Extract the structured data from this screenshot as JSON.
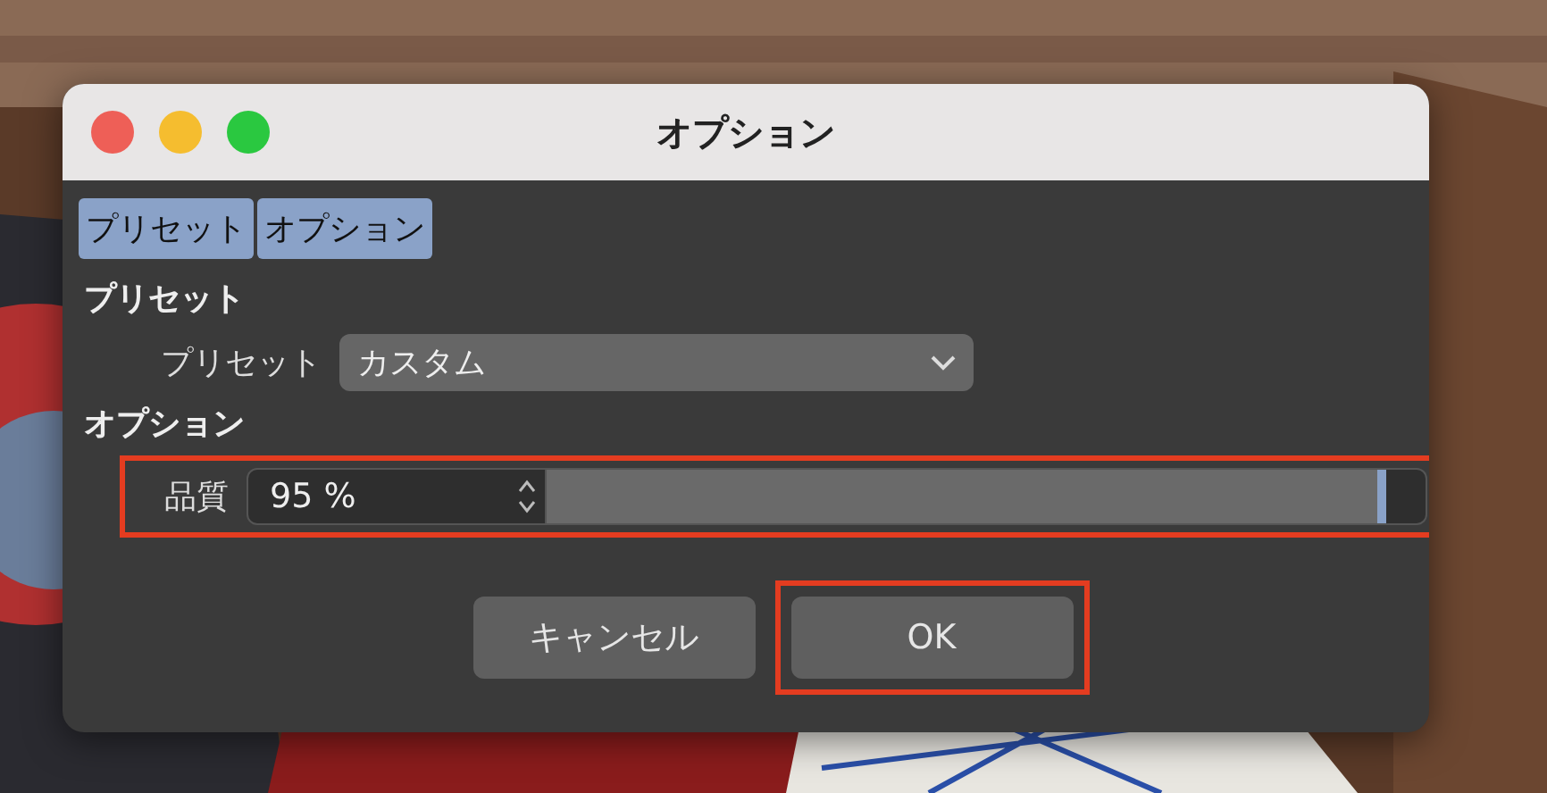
{
  "window": {
    "title": "オプション"
  },
  "tabs": [
    {
      "label": "プリセット"
    },
    {
      "label": "オプション"
    }
  ],
  "preset_section": {
    "heading": "プリセット",
    "label": "プリセット",
    "value": "カスタム"
  },
  "options_section": {
    "heading": "オプション",
    "quality": {
      "label": "品質",
      "value": "95 %",
      "level": 0.95,
      "highlighted": true
    }
  },
  "buttons": [
    {
      "label": "キャンセル",
      "highlighted": false
    },
    {
      "label": "OK",
      "highlighted": true
    }
  ]
}
